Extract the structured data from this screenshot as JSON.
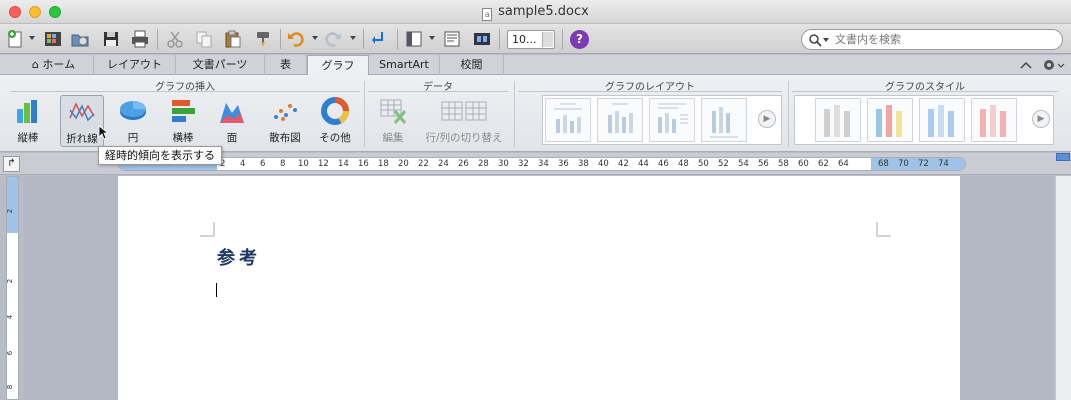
{
  "window": {
    "title": "sample5.docx"
  },
  "toolbar": {
    "zoom_value": "10...",
    "help_label": "?",
    "search_placeholder": "文書内を検索"
  },
  "tabs": [
    {
      "label": "ホーム"
    },
    {
      "label": "レイアウト"
    },
    {
      "label": "文書パーツ"
    },
    {
      "label": "表"
    },
    {
      "label": "グラフ"
    },
    {
      "label": "SmartArt"
    },
    {
      "label": "校閲"
    }
  ],
  "ribbon": {
    "groups": {
      "insert": "グラフの挿入",
      "data": "データ",
      "layout": "グラフのレイアウト",
      "style": "グラフのスタイル"
    },
    "insert_buttons": [
      {
        "label": "縦棒"
      },
      {
        "label": "折れ線"
      },
      {
        "label": "円"
      },
      {
        "label": "横棒"
      },
      {
        "label": "面"
      },
      {
        "label": "散布図"
      },
      {
        "label": "その他"
      }
    ],
    "data_buttons": [
      {
        "label": "編集"
      },
      {
        "label": "行/列の切り替え"
      }
    ]
  },
  "tooltip": {
    "text": "経時的傾向を表示する"
  },
  "ruler": {
    "numbers": [
      "2",
      "4",
      "6",
      "8",
      "10",
      "12",
      "14",
      "16",
      "18",
      "20",
      "22",
      "24",
      "26",
      "28",
      "30",
      "32",
      "34",
      "36",
      "38",
      "40",
      "42",
      "44",
      "46",
      "48",
      "50",
      "52",
      "54",
      "56",
      "58",
      "60",
      "62",
      "64",
      "68",
      "70",
      "72",
      "74"
    ]
  },
  "vruler": {
    "numbers": [
      "2",
      "2",
      "4",
      "6",
      "8"
    ]
  },
  "document": {
    "heading": "参考"
  },
  "colors": {
    "accent": "#1f3763",
    "ruler_margin": "#9fc3e6",
    "help": "#7b3bb5"
  }
}
